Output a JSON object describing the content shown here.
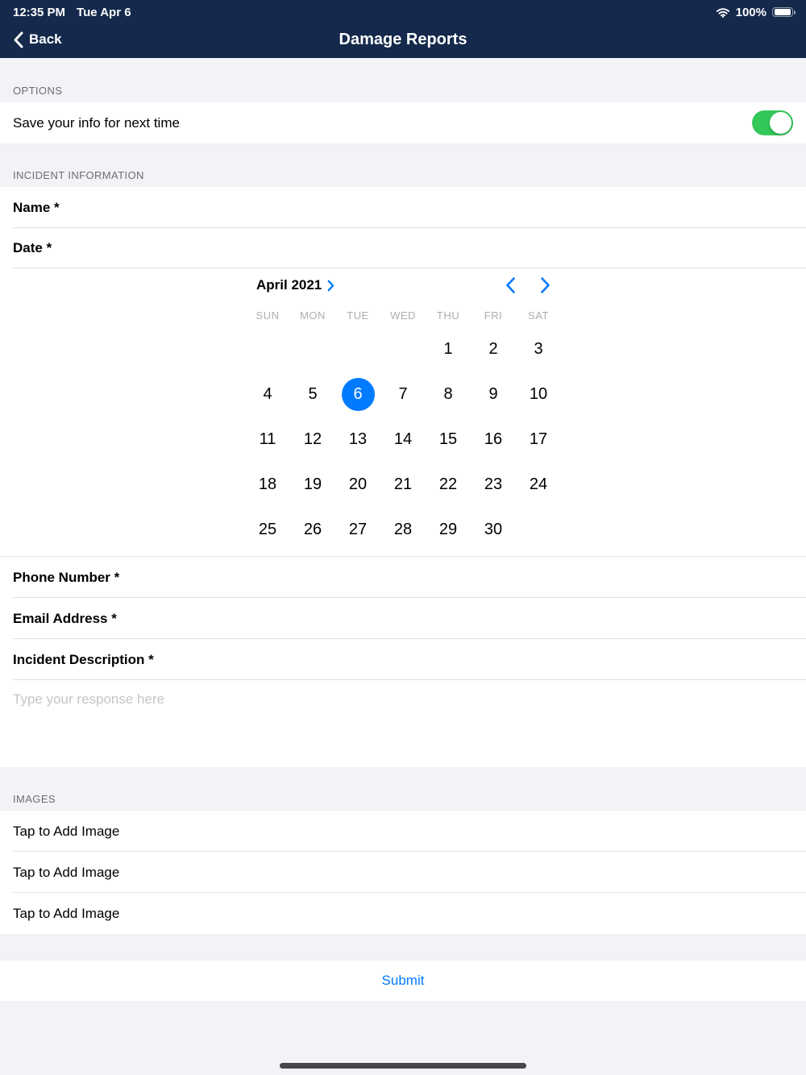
{
  "colors": {
    "navy": "#14294B",
    "blue": "#007AFF",
    "green": "#34C759",
    "bg": "#F2F2F7",
    "divider": "#E0E0E3",
    "section-text": "#6D6D72",
    "muted": "#AEAEB2",
    "placeholder": "#C5C5C9",
    "home-indicator": "#47474A"
  },
  "status_bar": {
    "time": "12:35 PM",
    "date": "Tue Apr 6",
    "battery_percent": "100%"
  },
  "nav": {
    "back_label": "Back",
    "title": "Damage Reports"
  },
  "options_section": {
    "header": "OPTIONS",
    "save_row": {
      "label": "Save your info for next time",
      "toggle_state": "on"
    }
  },
  "incident_section": {
    "header": "INCIDENT INFORMATION",
    "name_label": "Name *",
    "date_label": "Date *",
    "phone_label": "Phone Number *",
    "email_label": "Email Address *",
    "description_label": "Incident Description *",
    "description_placeholder": "Type your response here"
  },
  "calendar": {
    "month_label": "April 2021",
    "weekdays": [
      "SUN",
      "MON",
      "TUE",
      "WED",
      "THU",
      "FRI",
      "SAT"
    ],
    "weeks": [
      [
        "",
        "",
        "",
        "",
        "1",
        "2",
        "3"
      ],
      [
        "4",
        "5",
        "6",
        "7",
        "8",
        "9",
        "10"
      ],
      [
        "11",
        "12",
        "13",
        "14",
        "15",
        "16",
        "17"
      ],
      [
        "18",
        "19",
        "20",
        "21",
        "22",
        "23",
        "24"
      ],
      [
        "25",
        "26",
        "27",
        "28",
        "29",
        "30",
        ""
      ]
    ],
    "selected_day": "6"
  },
  "images_section": {
    "header": "IMAGES",
    "rows": [
      "Tap to Add Image",
      "Tap to Add Image",
      "Tap to Add Image"
    ]
  },
  "footer": {
    "submit_label": "Submit"
  }
}
